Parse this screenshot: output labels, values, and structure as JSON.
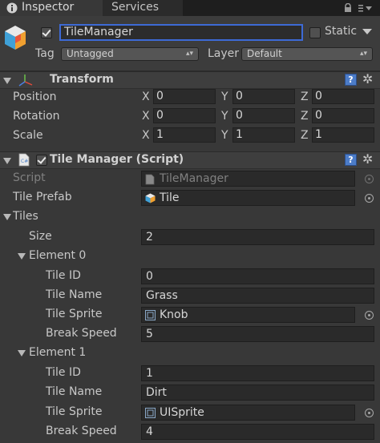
{
  "tabs": {
    "inspector": "Inspector",
    "services": "Services"
  },
  "header": {
    "object_name": "TileManager",
    "active": true,
    "static_label": "Static",
    "static_checked": false,
    "tag_label": "Tag",
    "tag_value": "Untagged",
    "layer_label": "Layer",
    "layer_value": "Default"
  },
  "transform": {
    "title": "Transform",
    "rows": [
      {
        "label": "Position",
        "x": "0",
        "y": "0",
        "z": "0"
      },
      {
        "label": "Rotation",
        "x": "0",
        "y": "0",
        "z": "0"
      },
      {
        "label": "Scale",
        "x": "1",
        "y": "1",
        "z": "1"
      }
    ],
    "axis": {
      "x": "X",
      "y": "Y",
      "z": "Z"
    }
  },
  "script_component": {
    "title": "Tile Manager (Script)",
    "script_label": "Script",
    "script_value": "TileManager",
    "tile_prefab_label": "Tile Prefab",
    "tile_prefab_value": "Tile",
    "tiles_label": "Tiles",
    "size_label": "Size",
    "size_value": "2",
    "elements": [
      {
        "title": "Element 0",
        "tile_id_label": "Tile ID",
        "tile_id": "0",
        "tile_name_label": "Tile Name",
        "tile_name": "Grass",
        "tile_sprite_label": "Tile Sprite",
        "tile_sprite": "Knob",
        "break_speed_label": "Break Speed",
        "break_speed": "5"
      },
      {
        "title": "Element 1",
        "tile_id_label": "Tile ID",
        "tile_id": "1",
        "tile_name_label": "Tile Name",
        "tile_name": "Dirt",
        "tile_sprite_label": "Tile Sprite",
        "tile_sprite": "UISprite",
        "break_speed_label": "Break Speed",
        "break_speed": "4"
      }
    ]
  },
  "colors": {
    "background": "#383838",
    "accent": "#3d6ad6",
    "field": "#2a2a2a",
    "help": "#4c7cc8"
  },
  "icons": [
    "info-icon",
    "lock-icon",
    "menu-icon",
    "gameobject-cube-icon",
    "transform-axes-icon",
    "script-file-icon",
    "help-icon",
    "gear-icon",
    "prefab-icon",
    "sprite-icon",
    "object-picker-icon"
  ]
}
